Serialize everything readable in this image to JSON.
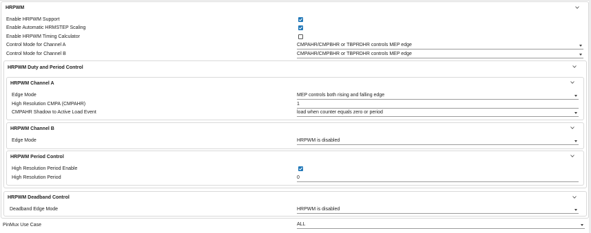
{
  "hrpwm": {
    "title": "HRPWM",
    "enable_support": {
      "label": "Enable HRPWM Support",
      "checked": true
    },
    "enable_auto_scaling": {
      "label": "Enable Automatic HRMSTEP Scaling",
      "checked": true
    },
    "enable_timing_calc": {
      "label": "Enable HRPWM Timing Calculator",
      "checked": false
    },
    "control_mode_a": {
      "label": "Control Mode for Channel A",
      "value": "CMPAHR/CMPBHR or TBPRDHR controls MEP edge"
    },
    "control_mode_b": {
      "label": "Control Mode for Channel B",
      "value": "CMPAHR/CMPBHR or TBPRDHR controls MEP edge"
    }
  },
  "duty_period": {
    "title": "HRPWM Duty and Period Control",
    "channel_a": {
      "title": "HRPWM Channel A",
      "edge_mode": {
        "label": "Edge Mode",
        "value": "MEP controls both rising and falling edge"
      },
      "cmpahr": {
        "label": "High Resolution CMPA (CMPAHR)",
        "value": "1"
      },
      "shadow_load": {
        "label": "CMPAHR Shadow to Active Load Event",
        "value": "load when counter equals zero or period"
      }
    },
    "channel_b": {
      "title": "HRPWM Channel B",
      "edge_mode": {
        "label": "Edge Mode",
        "value": "HRPWM is disabled"
      }
    },
    "period_control": {
      "title": "HRPWM Period Control",
      "period_enable": {
        "label": "High Resolution Period Enable",
        "checked": true
      },
      "period": {
        "label": "High Resolution Period",
        "value": "0"
      }
    }
  },
  "deadband": {
    "title": "HRPWM Deadband Control",
    "edge_mode": {
      "label": "Deadband Edge Mode",
      "value": "HRPWM is disabled"
    }
  },
  "pinmux": {
    "label": "PinMux Use Case",
    "value": "ALL"
  },
  "colors": {
    "accent": "#2178b8",
    "border": "#d9d9d9"
  }
}
